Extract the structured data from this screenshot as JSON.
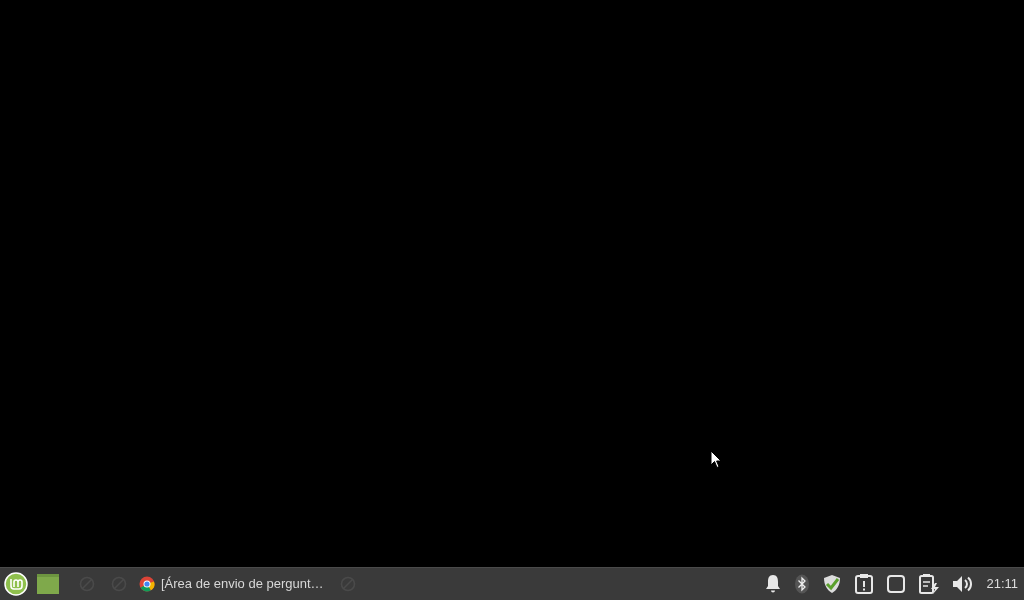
{
  "taskbar": {
    "window_button": {
      "title": "[Área de envio de pergunt…"
    },
    "clock": "21:11"
  }
}
